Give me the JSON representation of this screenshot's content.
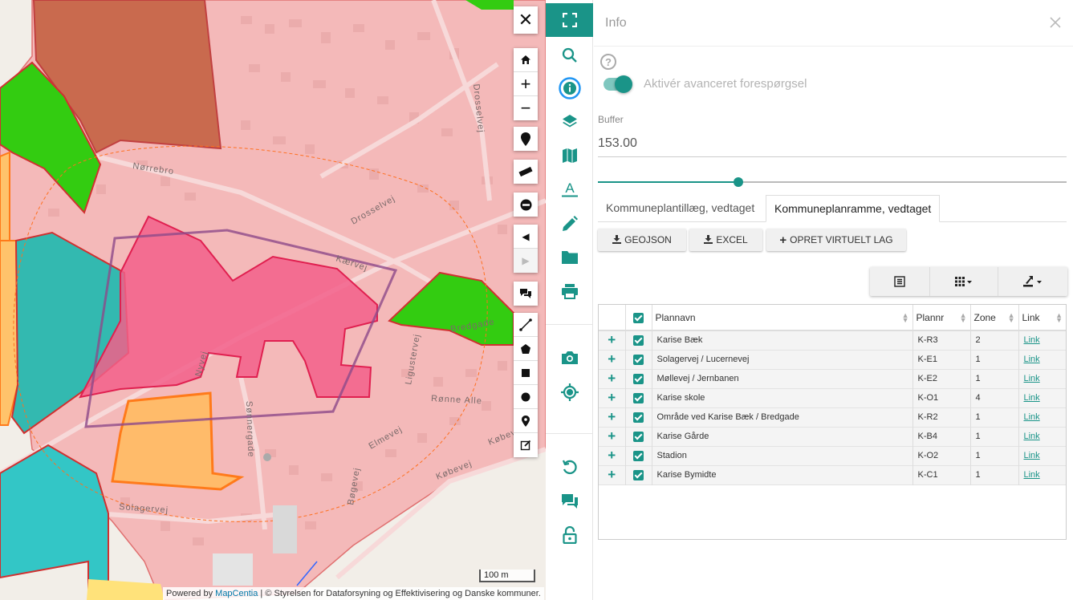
{
  "map": {
    "street_labels": [
      "Nørrebro",
      "Drosselvej",
      "Kærvej",
      "Ligustervej",
      "Rønne Alle",
      "Nyvej",
      "Sønnergade",
      "Elmevej",
      "Købevej",
      "Købevej",
      "Solagervej",
      "Bøgevej",
      "Bredgade",
      "Drosselvej"
    ],
    "scale_label": "100 m",
    "attribution": {
      "prefix": "Powered by",
      "link": "MapCentia",
      "suffix": "| © Styrelsen for Dataforsyning og Effektivisering og Danske kommuner."
    },
    "controls": [
      "close-icon",
      "home-icon",
      "zoom-in-icon",
      "zoom-out-icon",
      "marker-icon",
      "ruler-icon",
      "no-entry-icon",
      "arrow-left-icon",
      "arrow-right-icon",
      "speech-bubbles-icon",
      "polyline-icon",
      "polygon-icon",
      "rectangle-icon",
      "circle-icon",
      "point-icon",
      "edit-icon"
    ]
  },
  "toolbar": {
    "accent": "#1a9488",
    "icons": [
      "fullscreen-icon",
      "search-icon",
      "info-icon",
      "layers-icon",
      "map-icon",
      "text-icon",
      "pencil-icon",
      "folder-icon",
      "print-icon",
      "camera-icon",
      "locate-icon",
      "reset-icon",
      "chat-icon",
      "lock-icon"
    ]
  },
  "panel": {
    "title": "Info",
    "toggle_label": "Aktivér avanceret forespørgsel",
    "buffer_label": "Buffer",
    "buffer_value": "153.00",
    "slider_fraction": 0.3,
    "tabs": [
      {
        "label": "Kommuneplantillæg, vedtaget",
        "active": false
      },
      {
        "label": "Kommuneplanramme, vedtaget",
        "active": true
      }
    ],
    "actions": {
      "geojson": "GEOJSON",
      "excel": "EXCEL",
      "virtual_layer": "OPRET VIRTUELT LAG"
    }
  },
  "table": {
    "columns": [
      "Plannavn",
      "Plannr",
      "Zone",
      "Link"
    ],
    "rows": [
      {
        "plannavn": "Karise Bæk",
        "plannr": "K-R3",
        "zone": "2",
        "link": "Link"
      },
      {
        "plannavn": "Solagervej / Lucernevej",
        "plannr": "K-E1",
        "zone": "1",
        "link": "Link"
      },
      {
        "plannavn": "Møllevej / Jernbanen",
        "plannr": "K-E2",
        "zone": "1",
        "link": "Link"
      },
      {
        "plannavn": "Karise skole",
        "plannr": "K-O1",
        "zone": "4",
        "link": "Link"
      },
      {
        "plannavn": "Område ved Karise Bæk / Bredgade",
        "plannr": "K-R2",
        "zone": "1",
        "link": "Link"
      },
      {
        "plannavn": "Karise Gårde",
        "plannr": "K-B4",
        "zone": "1",
        "link": "Link"
      },
      {
        "plannavn": "Stadion",
        "plannr": "K-O2",
        "zone": "1",
        "link": "Link"
      },
      {
        "plannavn": "Karise Bymidte",
        "plannr": "K-C1",
        "zone": "1",
        "link": "Link"
      }
    ]
  }
}
